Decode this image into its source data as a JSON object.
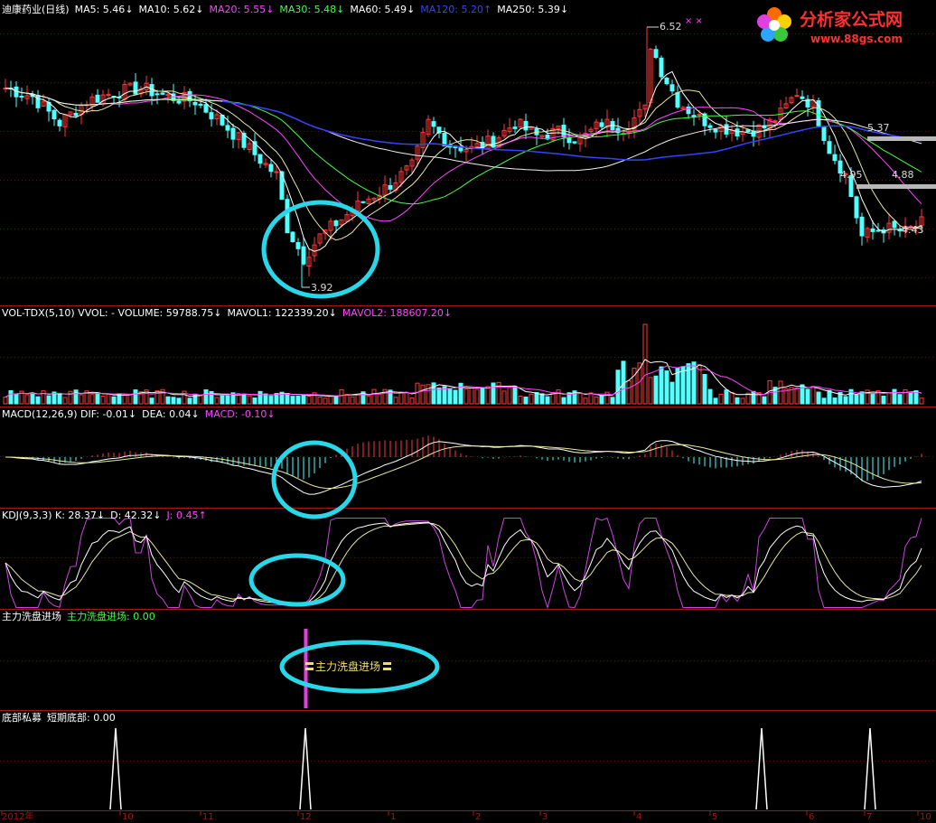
{
  "logo": {
    "brand_text": "分析家公式网",
    "url_text": "www.88gs.com"
  },
  "price_panel": {
    "title": "迪康药业(日线)",
    "ma": [
      {
        "label": "MA5: 5.46",
        "arrow": "↓",
        "color": "#ffffff"
      },
      {
        "label": "MA10: 5.62",
        "arrow": "↓",
        "color": "#ffffff"
      },
      {
        "label": "MA20: 5.55",
        "arrow": "↓",
        "color": "#ff44ff"
      },
      {
        "label": "MA30: 5.48",
        "arrow": "↓",
        "color": "#44ff44"
      },
      {
        "label": "MA60: 5.49",
        "arrow": "↓",
        "color": "#ffffff"
      },
      {
        "label": "MA120: 5.20",
        "arrow": "↑",
        "color": "#3344ff"
      },
      {
        "label": "MA250: 5.39",
        "arrow": "↓",
        "color": "#ffffff"
      }
    ],
    "high_label": "6.52",
    "low_label": "3.92",
    "price_marks": [
      "5.37",
      "4.95",
      "4.88",
      "4.43"
    ]
  },
  "volume_panel": {
    "header": [
      {
        "text": "VOL-TDX(5,10) VVOL: -  VOLUME: 59788.75↓",
        "color": "#ffffff"
      },
      {
        "text": "MAVOL1: 122339.20↓",
        "color": "#ffffff"
      },
      {
        "text": "MAVOL2: 188607.20↓",
        "color": "#ff44ff"
      }
    ]
  },
  "macd_panel": {
    "header": [
      {
        "text": "MACD(12,26,9) DIF: -0.01↓",
        "color": "#ffffff"
      },
      {
        "text": "DEA: 0.04↓",
        "color": "#ffffff"
      },
      {
        "text": "MACD: -0.10↓",
        "color": "#ff44ff"
      }
    ]
  },
  "kdj_panel": {
    "header": [
      {
        "text": "KDJ(9,3,3) K: 28.37↓",
        "color": "#ffffff"
      },
      {
        "text": "D: 42.32↓",
        "color": "#ffffff"
      },
      {
        "text": "J: 0.45↑",
        "color": "#ff44ff"
      }
    ]
  },
  "signal_panel": {
    "title": "主力洗盘进场",
    "value_text": "主力洗盘进场: 0.00",
    "marker_label": "主力洗盘进场"
  },
  "bottom_panel": {
    "title": "底部私募",
    "value_text": "短期底部: 0.00"
  },
  "time_axis": {
    "labels": [
      "2012年",
      "10",
      "11",
      "12",
      "1",
      "2",
      "3",
      "4",
      "5",
      "6",
      "7",
      "10"
    ]
  },
  "chart_data": [
    {
      "type": "line",
      "panel": "candlestick price",
      "y_range": [
        3.7,
        6.7
      ],
      "annotated_points": [
        {
          "label": "high",
          "value": 6.52
        },
        {
          "label": "low",
          "value": 3.92
        }
      ],
      "series": [
        {
          "name": "MA5",
          "last": 5.46
        },
        {
          "name": "MA10",
          "last": 5.62
        },
        {
          "name": "MA20",
          "last": 5.55
        },
        {
          "name": "MA30",
          "last": 5.48
        },
        {
          "name": "MA60",
          "last": 5.49
        },
        {
          "name": "MA120",
          "last": 5.2
        },
        {
          "name": "MA250",
          "last": 5.39
        }
      ]
    },
    {
      "type": "bar",
      "panel": "volume",
      "series": [
        {
          "name": "VOLUME",
          "last": 59788.75
        },
        {
          "name": "MAVOL1",
          "last": 122339.2
        },
        {
          "name": "MAVOL2",
          "last": 188607.2
        }
      ]
    },
    {
      "type": "line",
      "panel": "MACD",
      "series": [
        {
          "name": "DIF",
          "last": -0.01
        },
        {
          "name": "DEA",
          "last": 0.04
        },
        {
          "name": "MACD",
          "last": -0.1
        }
      ]
    },
    {
      "type": "line",
      "panel": "KDJ",
      "series": [
        {
          "name": "K",
          "last": 28.37
        },
        {
          "name": "D",
          "last": 42.32
        },
        {
          "name": "J",
          "last": 0.45
        }
      ]
    },
    {
      "type": "bar",
      "panel": "短期底部",
      "series": [
        {
          "name": "短期底部",
          "last": 0.0
        }
      ]
    }
  ]
}
